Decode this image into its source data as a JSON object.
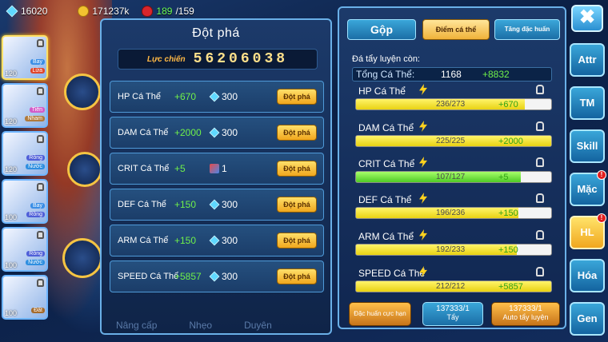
{
  "resources": {
    "gems": "16020",
    "gold": "171237k",
    "stamina_current": "189",
    "stamina_max": "/159"
  },
  "team": [
    {
      "level": "120",
      "tag1": "Bay",
      "tag2": "Lửa",
      "tag1_color": "#3a8ee6",
      "tag2_color": "#e0462b"
    },
    {
      "level": "120",
      "tag1": "Tiên",
      "tag2": "Nham",
      "tag1_color": "#d35bc8",
      "tag2_color": "#b07a3c"
    },
    {
      "level": "120",
      "tag1": "Rồng",
      "tag2": "Nước",
      "tag1_color": "#4f5fd8",
      "tag2_color": "#2f8fe0"
    },
    {
      "level": "100",
      "tag1": "Bay",
      "tag2": "Rồng",
      "tag1_color": "#3a8ee6",
      "tag2_color": "#4f5fd8"
    },
    {
      "level": "100",
      "tag1": "Rồng",
      "tag2": "Nước",
      "tag1_color": "#4f5fd8",
      "tag2_color": "#2f8fe0"
    },
    {
      "level": "100",
      "tag1": "",
      "tag2": "Đất",
      "tag1_color": "#3a8ee6",
      "tag2_color": "#a56b2c"
    }
  ],
  "breakthrough": {
    "title": "Đột phá",
    "power_label": "Lực chiến",
    "power_value": "56206038",
    "rows": [
      {
        "name": "HP Cá Thể",
        "bonus": "+670",
        "cost": "300",
        "cost_icon": "gem",
        "button": "Đột phá"
      },
      {
        "name": "DAM Cá Thể",
        "bonus": "+2000",
        "cost": "300",
        "cost_icon": "gem",
        "button": "Đột phá"
      },
      {
        "name": "CRIT Cá Thể",
        "bonus": "+5",
        "cost": "1",
        "cost_icon": "scroll",
        "button": "Đột phá"
      },
      {
        "name": "DEF Cá Thể",
        "bonus": "+150",
        "cost": "300",
        "cost_icon": "gem",
        "button": "Đột phá"
      },
      {
        "name": "ARM Cá Thể",
        "bonus": "+150",
        "cost": "300",
        "cost_icon": "gem",
        "button": "Đột phá"
      },
      {
        "name": "SPEED Cá Thể",
        "bonus": "+5857",
        "cost": "300",
        "cost_icon": "gem",
        "button": "Đột phá"
      }
    ],
    "bottom_tabs": [
      "Nâng cấp",
      "Nhẹo",
      "Duyên"
    ]
  },
  "training": {
    "tabs": {
      "gop": "Gộp",
      "diem": "Điểm cá thể",
      "tang": "Tăng đặc huấn"
    },
    "remaining_label": "Đá tẩy luyện còn:",
    "total_label": "Tổng Cá Thể:",
    "total_value": "1168",
    "total_bonus": "+8832",
    "stats": [
      {
        "name": "HP Cá Thể",
        "current": "236",
        "max": "/273",
        "text": "236/273",
        "bonus": "+670",
        "fill": 0.864,
        "color": "yellow"
      },
      {
        "name": "DAM Cá Thể",
        "current": "225",
        "max": "/225",
        "text": "225/225",
        "bonus": "+2000",
        "fill": 1.0,
        "color": "yellow"
      },
      {
        "name": "CRIT Cá Thể",
        "current": "107",
        "max": "/127",
        "text": "107/127",
        "bonus": "+5",
        "fill": 0.843,
        "color": "green"
      },
      {
        "name": "DEF Cá Thể",
        "current": "196",
        "max": "/236",
        "text": "196/236",
        "bonus": "+150",
        "fill": 0.83,
        "color": "yellow"
      },
      {
        "name": "ARM Cá Thể",
        "current": "192",
        "max": "/233",
        "text": "192/233",
        "bonus": "+150",
        "fill": 0.824,
        "color": "yellow"
      },
      {
        "name": "SPEED Cá Thể",
        "current": "212",
        "max": "/212",
        "text": "212/212",
        "bonus": "+5857",
        "fill": 1.0,
        "color": "yellow"
      }
    ],
    "buttons": {
      "special": "Đặc huấn cực hạn",
      "wash_count": "137333/1",
      "wash_label": "Tẩy",
      "auto_count": "137333/1",
      "auto_label": "Auto tẩy luyện"
    }
  },
  "sidenav": {
    "close": "✖",
    "items": [
      {
        "label": "Attr",
        "active": false,
        "badge": ""
      },
      {
        "label": "TM",
        "active": false,
        "badge": ""
      },
      {
        "label": "Skill",
        "active": false,
        "badge": ""
      },
      {
        "label": "Mặc",
        "active": false,
        "badge": "!"
      },
      {
        "label": "HL",
        "active": true,
        "badge": "!"
      },
      {
        "label": "Hóa",
        "active": false,
        "badge": ""
      },
      {
        "label": "Gen",
        "active": false,
        "badge": ""
      }
    ]
  }
}
